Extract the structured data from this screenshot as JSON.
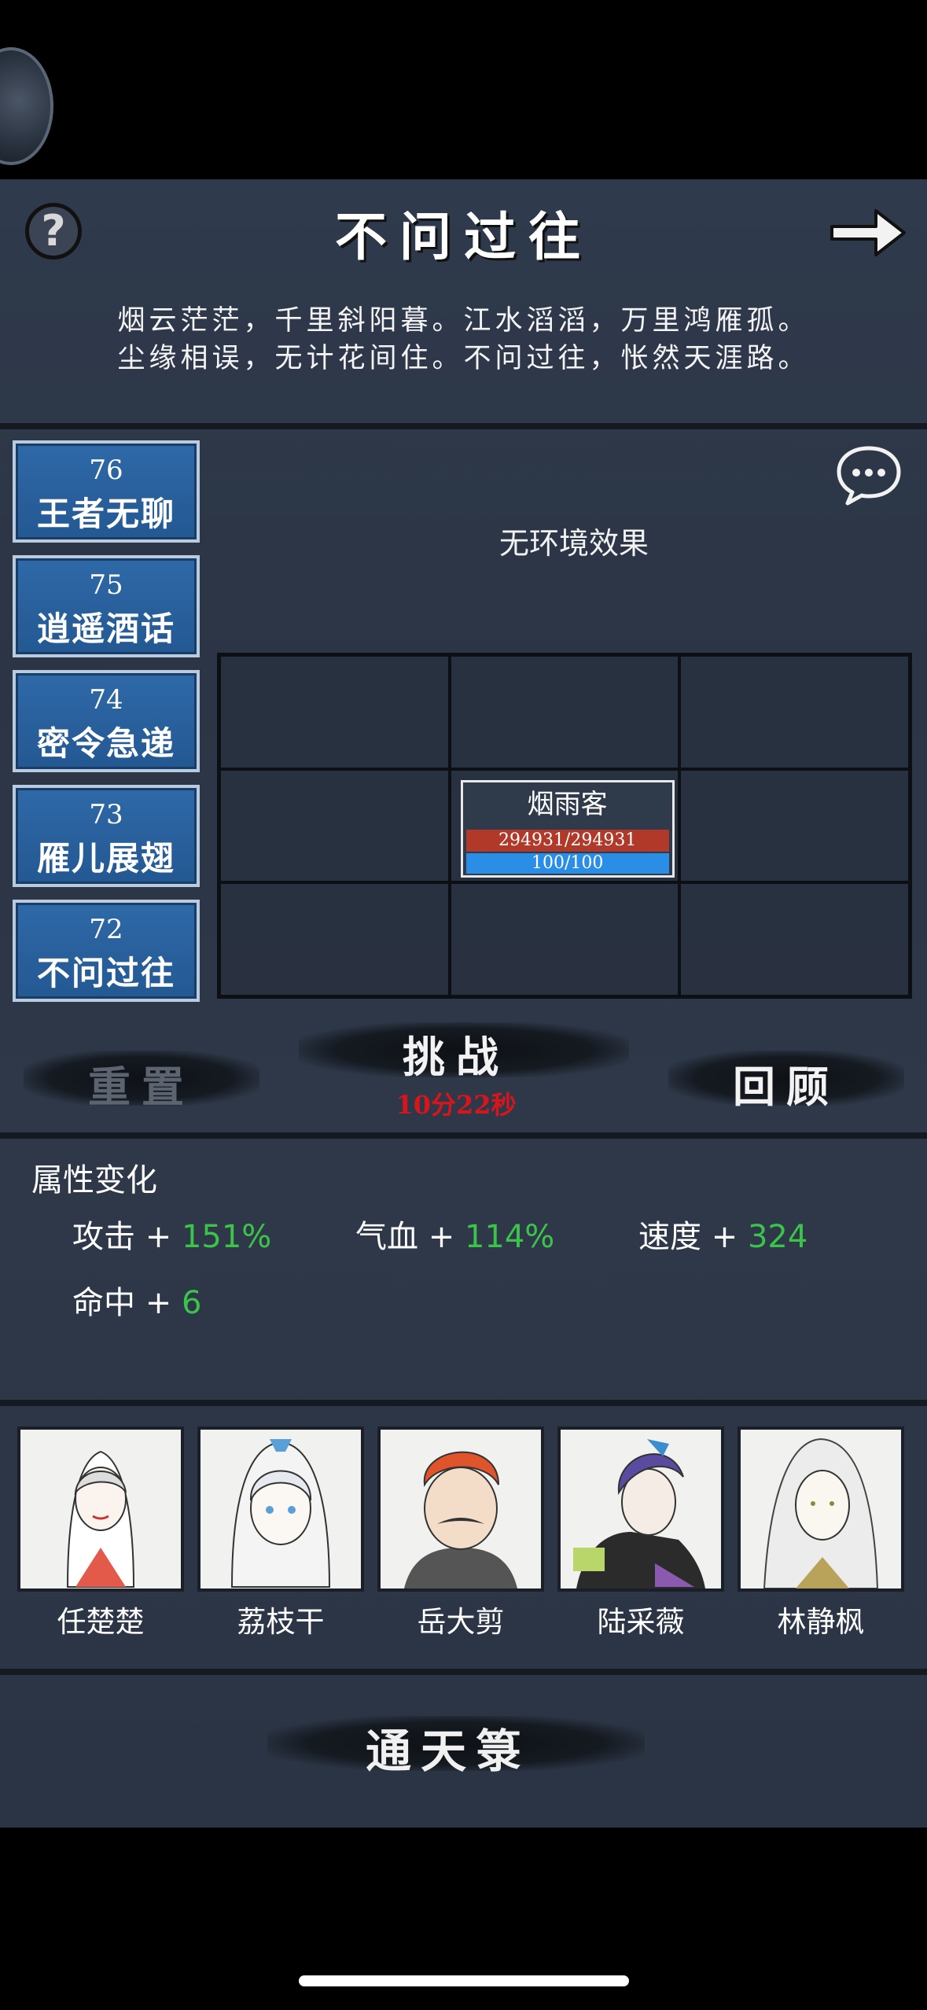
{
  "header": {
    "title": "不问过往",
    "help_icon": "question-mark",
    "next_icon": "arrow-right"
  },
  "poem": {
    "line1": "烟云茫茫，千里斜阳暮。江水滔滔，万里鸿雁孤。",
    "line2": "尘缘相误，无计花间住。不问过往，怅然天涯路。"
  },
  "levels": [
    {
      "num": "76",
      "name": "王者无聊"
    },
    {
      "num": "75",
      "name": "逍遥酒话"
    },
    {
      "num": "74",
      "name": "密令急递"
    },
    {
      "num": "73",
      "name": "雁儿展翅"
    },
    {
      "num": "72",
      "name": "不问过往"
    }
  ],
  "environment": {
    "text": "无环境效果",
    "chat_icon": "speech-bubble"
  },
  "formation": {
    "unit": {
      "name": "烟雨客",
      "hp": "294931/294931",
      "mp": "100/100",
      "hp_fill": 1.0,
      "mp_fill": 1.0
    }
  },
  "actions": {
    "reset": "重置",
    "challenge": "挑战",
    "timer": "10分22秒",
    "review": "回顾"
  },
  "attributes": {
    "title": "属性变化",
    "items": [
      {
        "label": "攻击",
        "plus": "+",
        "value": "151%"
      },
      {
        "label": "气血",
        "plus": "+",
        "value": "114%"
      },
      {
        "label": "速度",
        "plus": "+",
        "value": "324"
      },
      {
        "label": "命中",
        "plus": "+",
        "value": "6"
      }
    ]
  },
  "characters": [
    {
      "name": "任楚楚"
    },
    {
      "name": "荔枝干"
    },
    {
      "name": "岳大剪"
    },
    {
      "name": "陆采薇"
    },
    {
      "name": "林静枫"
    }
  ],
  "footer": {
    "button": "通天箓"
  },
  "colors": {
    "panel": "#2f3a4c",
    "level_tile": "#2f69a8",
    "hp": "#b0392a",
    "mp": "#2a8ee6",
    "bonus": "#3cc44a",
    "timer": "#d6161c"
  }
}
